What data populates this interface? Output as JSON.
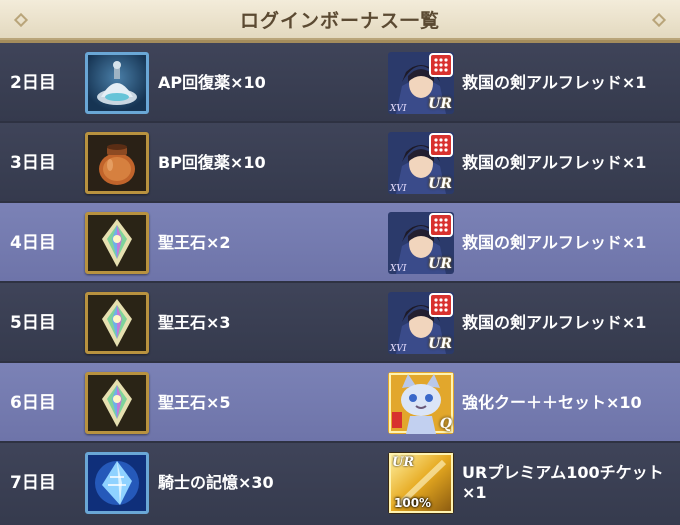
{
  "header": {
    "title": "ログインボーナス一覧"
  },
  "rows": [
    {
      "day": "2日目",
      "item": {
        "icon": "ap-potion-icon",
        "name": "AP回復薬×10"
      },
      "reward": {
        "icon": "knight-portrait-icon",
        "tag": "XVI",
        "badge": "UR",
        "name": "救国の剣アルフレッド×1"
      }
    },
    {
      "day": "3日目",
      "item": {
        "icon": "bp-jar-icon",
        "name": "BP回復薬×10"
      },
      "reward": {
        "icon": "knight-portrait-icon",
        "tag": "XVI",
        "badge": "UR",
        "name": "救国の剣アルフレッド×1"
      }
    },
    {
      "day": "4日目",
      "item": {
        "icon": "holy-stone-icon",
        "name": "聖王石×2"
      },
      "reward": {
        "icon": "knight-portrait-icon",
        "tag": "XVI",
        "badge": "UR",
        "name": "救国の剣アルフレッド×1"
      }
    },
    {
      "day": "5日目",
      "item": {
        "icon": "holy-stone-icon",
        "name": "聖王石×3"
      },
      "reward": {
        "icon": "knight-portrait-icon",
        "tag": "XVI",
        "badge": "UR",
        "name": "救国の剣アルフレッド×1"
      }
    },
    {
      "day": "6日目",
      "item": {
        "icon": "holy-stone-icon",
        "name": "聖王石×5"
      },
      "reward": {
        "icon": "enhance-cat-icon",
        "tag": "",
        "badge": "Q",
        "name": "強化クー＋＋セット×10"
      }
    },
    {
      "day": "7日目",
      "item": {
        "icon": "knight-memory-crystal-icon",
        "name": "騎士の記憶×30"
      },
      "reward": {
        "icon": "ur-ticket-icon",
        "tag": "100%",
        "badge": "UR",
        "name": "URプレミアム100チケット×1"
      }
    }
  ],
  "colors": {
    "row_dark": "#3f4459",
    "row_light": "#7b82b6",
    "header_bg": "#efe8d5",
    "gold_frame": "#b8923f"
  }
}
